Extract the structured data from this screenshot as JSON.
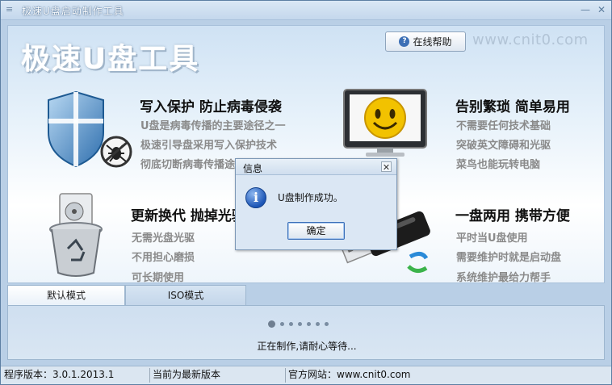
{
  "window": {
    "title": "极速U盘启动制作工具"
  },
  "header": {
    "brand_title": "极速U盘工具",
    "help_label": "在线帮助",
    "site_text": "www.cnit0.com"
  },
  "features": [
    {
      "title": "写入保护 防止病毒侵袭",
      "lines": [
        "U盘是病毒传播的主要途径之一",
        "极速引导盘采用写入保护技术",
        "彻底切断病毒传播途径"
      ],
      "icon": "shield-antivirus-icon"
    },
    {
      "title": "告别繁琐 简单易用",
      "lines": [
        "不需要任何技术基础",
        "突破英文障碍和光驱",
        "菜鸟也能玩转电脑"
      ],
      "icon": "smiley-monitor-icon"
    },
    {
      "title": "更新换代 抛掉光驱",
      "lines": [
        "无需光盘光驱",
        "不用担心磨损",
        "可长期使用"
      ],
      "icon": "disc-recycle-bin-icon"
    },
    {
      "title": "一盘两用 携带方便",
      "lines": [
        "平时当U盘使用",
        "需要维护时就是启动盘",
        "系统维护最给力帮手"
      ],
      "icon": "usb-drive-icon"
    }
  ],
  "tabs": [
    {
      "label": "默认模式",
      "active": true
    },
    {
      "label": "ISO模式",
      "active": false
    }
  ],
  "progress": {
    "text": "正在制作,请耐心等待..."
  },
  "status": {
    "version": "程序版本：3.0.1.2013.1",
    "update": "当前为最新版本",
    "website": "官方网站：www.cnit0.com"
  },
  "dialog": {
    "title": "信息",
    "message": "U盘制作成功。",
    "ok_label": "确定"
  },
  "colors": {
    "accent": "#3c6fb5",
    "window_bg": "#b9cfe6"
  }
}
